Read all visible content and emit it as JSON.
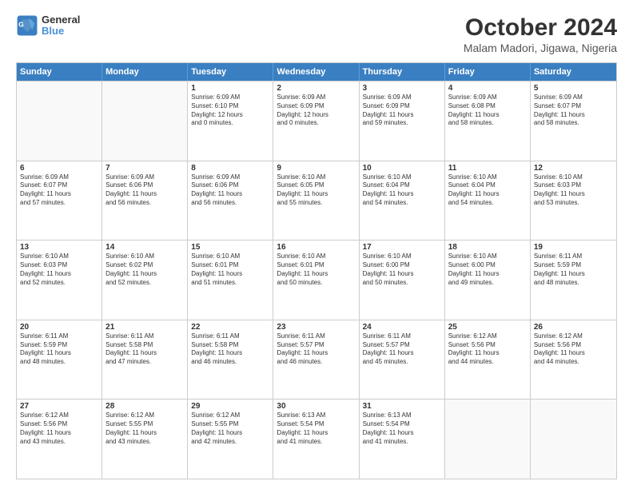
{
  "header": {
    "logo_line1": "General",
    "logo_line2": "Blue",
    "title": "October 2024",
    "subtitle": "Malam Madori, Jigawa, Nigeria"
  },
  "days_of_week": [
    "Sunday",
    "Monday",
    "Tuesday",
    "Wednesday",
    "Thursday",
    "Friday",
    "Saturday"
  ],
  "weeks": [
    [
      {
        "day": "",
        "info": ""
      },
      {
        "day": "",
        "info": ""
      },
      {
        "day": "1",
        "info": "Sunrise: 6:09 AM\nSunset: 6:10 PM\nDaylight: 12 hours\nand 0 minutes."
      },
      {
        "day": "2",
        "info": "Sunrise: 6:09 AM\nSunset: 6:09 PM\nDaylight: 12 hours\nand 0 minutes."
      },
      {
        "day": "3",
        "info": "Sunrise: 6:09 AM\nSunset: 6:09 PM\nDaylight: 11 hours\nand 59 minutes."
      },
      {
        "day": "4",
        "info": "Sunrise: 6:09 AM\nSunset: 6:08 PM\nDaylight: 11 hours\nand 58 minutes."
      },
      {
        "day": "5",
        "info": "Sunrise: 6:09 AM\nSunset: 6:07 PM\nDaylight: 11 hours\nand 58 minutes."
      }
    ],
    [
      {
        "day": "6",
        "info": "Sunrise: 6:09 AM\nSunset: 6:07 PM\nDaylight: 11 hours\nand 57 minutes."
      },
      {
        "day": "7",
        "info": "Sunrise: 6:09 AM\nSunset: 6:06 PM\nDaylight: 11 hours\nand 56 minutes."
      },
      {
        "day": "8",
        "info": "Sunrise: 6:09 AM\nSunset: 6:06 PM\nDaylight: 11 hours\nand 56 minutes."
      },
      {
        "day": "9",
        "info": "Sunrise: 6:10 AM\nSunset: 6:05 PM\nDaylight: 11 hours\nand 55 minutes."
      },
      {
        "day": "10",
        "info": "Sunrise: 6:10 AM\nSunset: 6:04 PM\nDaylight: 11 hours\nand 54 minutes."
      },
      {
        "day": "11",
        "info": "Sunrise: 6:10 AM\nSunset: 6:04 PM\nDaylight: 11 hours\nand 54 minutes."
      },
      {
        "day": "12",
        "info": "Sunrise: 6:10 AM\nSunset: 6:03 PM\nDaylight: 11 hours\nand 53 minutes."
      }
    ],
    [
      {
        "day": "13",
        "info": "Sunrise: 6:10 AM\nSunset: 6:03 PM\nDaylight: 11 hours\nand 52 minutes."
      },
      {
        "day": "14",
        "info": "Sunrise: 6:10 AM\nSunset: 6:02 PM\nDaylight: 11 hours\nand 52 minutes."
      },
      {
        "day": "15",
        "info": "Sunrise: 6:10 AM\nSunset: 6:01 PM\nDaylight: 11 hours\nand 51 minutes."
      },
      {
        "day": "16",
        "info": "Sunrise: 6:10 AM\nSunset: 6:01 PM\nDaylight: 11 hours\nand 50 minutes."
      },
      {
        "day": "17",
        "info": "Sunrise: 6:10 AM\nSunset: 6:00 PM\nDaylight: 11 hours\nand 50 minutes."
      },
      {
        "day": "18",
        "info": "Sunrise: 6:10 AM\nSunset: 6:00 PM\nDaylight: 11 hours\nand 49 minutes."
      },
      {
        "day": "19",
        "info": "Sunrise: 6:11 AM\nSunset: 5:59 PM\nDaylight: 11 hours\nand 48 minutes."
      }
    ],
    [
      {
        "day": "20",
        "info": "Sunrise: 6:11 AM\nSunset: 5:59 PM\nDaylight: 11 hours\nand 48 minutes."
      },
      {
        "day": "21",
        "info": "Sunrise: 6:11 AM\nSunset: 5:58 PM\nDaylight: 11 hours\nand 47 minutes."
      },
      {
        "day": "22",
        "info": "Sunrise: 6:11 AM\nSunset: 5:58 PM\nDaylight: 11 hours\nand 46 minutes."
      },
      {
        "day": "23",
        "info": "Sunrise: 6:11 AM\nSunset: 5:57 PM\nDaylight: 11 hours\nand 46 minutes."
      },
      {
        "day": "24",
        "info": "Sunrise: 6:11 AM\nSunset: 5:57 PM\nDaylight: 11 hours\nand 45 minutes."
      },
      {
        "day": "25",
        "info": "Sunrise: 6:12 AM\nSunset: 5:56 PM\nDaylight: 11 hours\nand 44 minutes."
      },
      {
        "day": "26",
        "info": "Sunrise: 6:12 AM\nSunset: 5:56 PM\nDaylight: 11 hours\nand 44 minutes."
      }
    ],
    [
      {
        "day": "27",
        "info": "Sunrise: 6:12 AM\nSunset: 5:56 PM\nDaylight: 11 hours\nand 43 minutes."
      },
      {
        "day": "28",
        "info": "Sunrise: 6:12 AM\nSunset: 5:55 PM\nDaylight: 11 hours\nand 43 minutes."
      },
      {
        "day": "29",
        "info": "Sunrise: 6:12 AM\nSunset: 5:55 PM\nDaylight: 11 hours\nand 42 minutes."
      },
      {
        "day": "30",
        "info": "Sunrise: 6:13 AM\nSunset: 5:54 PM\nDaylight: 11 hours\nand 41 minutes."
      },
      {
        "day": "31",
        "info": "Sunrise: 6:13 AM\nSunset: 5:54 PM\nDaylight: 11 hours\nand 41 minutes."
      },
      {
        "day": "",
        "info": ""
      },
      {
        "day": "",
        "info": ""
      }
    ]
  ]
}
